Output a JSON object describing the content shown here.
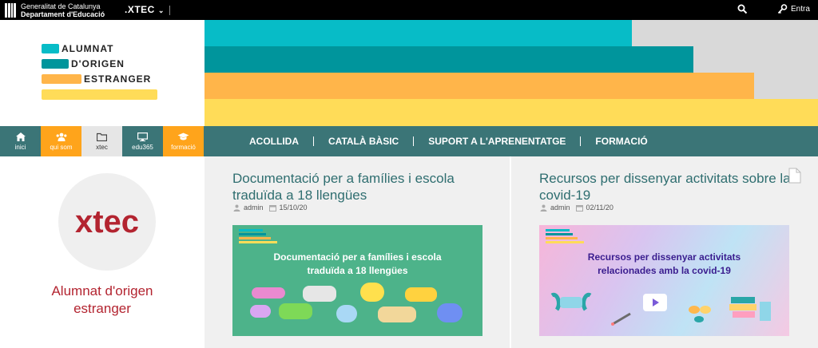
{
  "topbar": {
    "gov_line1": "Generalitat de Catalunya",
    "gov_line2": "Departament d'Educació",
    "xtec_label": ".XTEC",
    "login_label": "Entra"
  },
  "logo": {
    "line1": "ALUMNAT",
    "line2": "D'ORIGEN",
    "line3": "ESTRANGER"
  },
  "colors": {
    "teal": "#07bcc7",
    "dark_teal": "#00959c",
    "orange": "#ffb54a",
    "yellow": "#ffdc58",
    "nav_bg": "#3b7577",
    "brand_red": "#b32430"
  },
  "nav_buttons": [
    {
      "label": "inici",
      "icon": "home-icon"
    },
    {
      "label": "qui som",
      "icon": "users-icon"
    },
    {
      "label": "xtec",
      "icon": "folder-icon"
    },
    {
      "label": "edu365",
      "icon": "monitor-icon"
    },
    {
      "label": "formació",
      "icon": "graduation-cap-icon"
    }
  ],
  "menu": [
    "ACOLLIDA",
    "CATALÀ BÀSIC",
    "SUPORT A L'APRENENTATGE",
    "FORMACIÓ"
  ],
  "sidebar": {
    "logo_text": "xtec",
    "site_name_line1": "Alumnat d'origen",
    "site_name_line2": "estranger"
  },
  "posts": [
    {
      "title_line1": "Documentació per a famílies i escola",
      "title_line2": "traduïda a 18 llengües",
      "author": "admin",
      "date": "15/10/20",
      "image_line1": "Documentació per a famílies i escola",
      "image_line2": "traduïda a 18 llengües"
    },
    {
      "title_line1": "Recursos per dissenyar activitats sobre la",
      "title_line2": "covid-19",
      "author": "admin",
      "date": "02/11/20",
      "image_line1": "Recursos per dissenyar activitats",
      "image_line2": "relacionades amb la covid-19"
    }
  ],
  "thumb_logo": [
    "ALUMNAT",
    "D'ORIGEN",
    "ESTRANGER"
  ]
}
